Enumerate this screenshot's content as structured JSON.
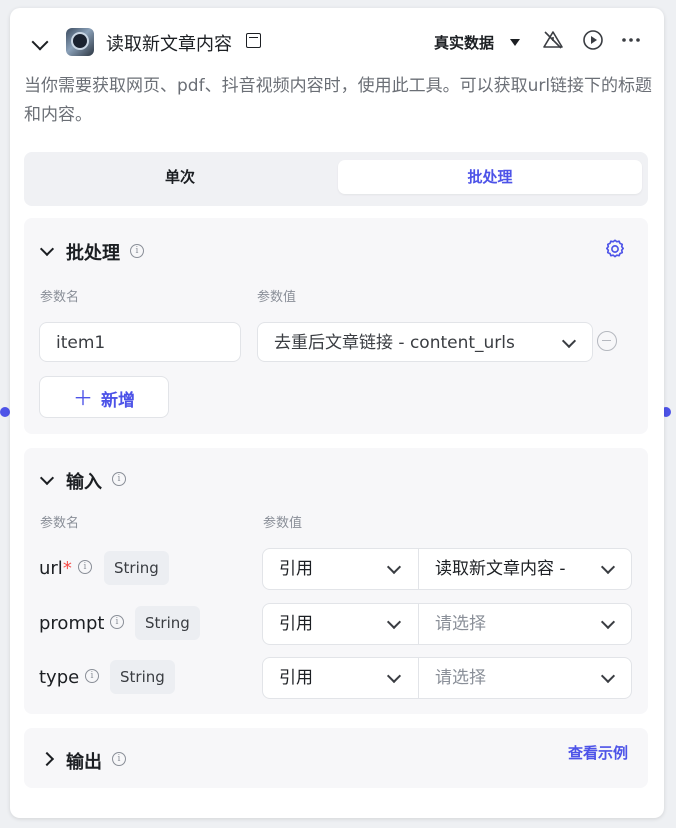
{
  "header": {
    "title": "读取新文章内容",
    "data_mode": "真实数据",
    "description": "当你需要获取网页、pdf、抖音视频内容时，使用此工具。可以获取url链接下的标题和内容。"
  },
  "tabs": [
    {
      "label": "单次",
      "active": false
    },
    {
      "label": "批处理",
      "active": true
    }
  ],
  "batch": {
    "title": "批处理",
    "col_name": "参数名",
    "col_value": "参数值",
    "rows": [
      {
        "name": "item1",
        "value": "去重后文章链接 - content_urls"
      }
    ],
    "add_label": "新增"
  },
  "input": {
    "title": "输入",
    "col_name": "参数名",
    "col_value": "参数值",
    "params": [
      {
        "name": "url",
        "required_mark": "*",
        "type": "String",
        "source": "引用",
        "value": "读取新文章内容 -"
      },
      {
        "name": "prompt",
        "type": "String",
        "source": "引用",
        "value": "请选择"
      },
      {
        "name": "type",
        "type": "String",
        "source": "引用",
        "value": "请选择"
      }
    ]
  },
  "output": {
    "title": "输出",
    "example_link": "查看示例"
  },
  "colors": {
    "accent": "#4d53e8",
    "required": "#f54a45"
  }
}
